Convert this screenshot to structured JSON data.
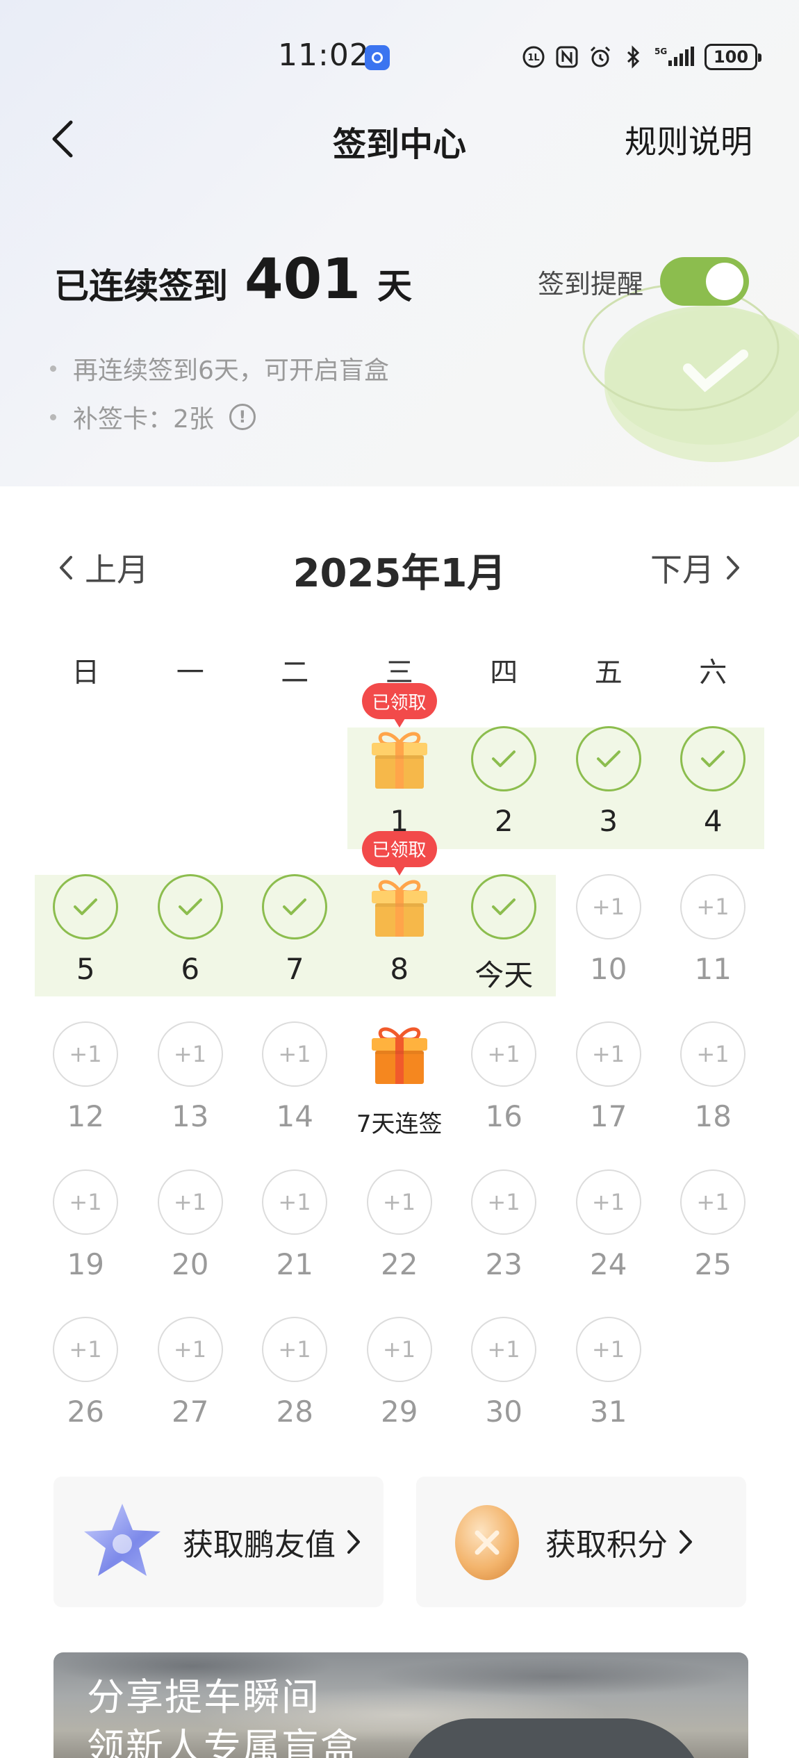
{
  "status_bar": {
    "time": "11:02",
    "battery": "100"
  },
  "nav": {
    "title": "签到中心",
    "rules_label": "规则说明"
  },
  "streak": {
    "prefix": "已连续签到",
    "days": "401",
    "suffix": "天"
  },
  "reminder": {
    "label": "签到提醒",
    "enabled": true
  },
  "tips": [
    "再连续签到6天，可开启盲盒",
    "补签卡：2张"
  ],
  "calendar": {
    "prev_label": "上月",
    "next_label": "下月",
    "month_title": "2025年1月",
    "weekdays": [
      "日",
      "一",
      "二",
      "三",
      "四",
      "五",
      "六"
    ],
    "claimed_badge": "已领取",
    "future_mark": "+1",
    "weeks": [
      [
        {
          "label": ""
        },
        {
          "label": ""
        },
        {
          "label": ""
        },
        {
          "label": "1",
          "state": "gift-claimed"
        },
        {
          "label": "2",
          "state": "checked"
        },
        {
          "label": "3",
          "state": "checked"
        },
        {
          "label": "4",
          "state": "checked"
        }
      ],
      [
        {
          "label": "5",
          "state": "checked"
        },
        {
          "label": "6",
          "state": "checked"
        },
        {
          "label": "7",
          "state": "checked"
        },
        {
          "label": "8",
          "state": "gift-claimed"
        },
        {
          "label": "今天",
          "state": "checked"
        },
        {
          "label": "10",
          "state": "future"
        },
        {
          "label": "11",
          "state": "future"
        }
      ],
      [
        {
          "label": "12",
          "state": "future"
        },
        {
          "label": "13",
          "state": "future"
        },
        {
          "label": "14",
          "state": "future"
        },
        {
          "label": "7天连签",
          "state": "gift"
        },
        {
          "label": "16",
          "state": "future"
        },
        {
          "label": "17",
          "state": "future"
        },
        {
          "label": "18",
          "state": "future"
        }
      ],
      [
        {
          "label": "19",
          "state": "future"
        },
        {
          "label": "20",
          "state": "future"
        },
        {
          "label": "21",
          "state": "future"
        },
        {
          "label": "22",
          "state": "future"
        },
        {
          "label": "23",
          "state": "future"
        },
        {
          "label": "24",
          "state": "future"
        },
        {
          "label": "25",
          "state": "future"
        }
      ],
      [
        {
          "label": "26",
          "state": "future"
        },
        {
          "label": "27",
          "state": "future"
        },
        {
          "label": "28",
          "state": "future"
        },
        {
          "label": "29",
          "state": "future"
        },
        {
          "label": "30",
          "state": "future"
        },
        {
          "label": "31",
          "state": "future"
        },
        {
          "label": ""
        }
      ]
    ]
  },
  "cards": [
    {
      "label": "获取鹏友值",
      "icon": "star-icon"
    },
    {
      "label": "获取积分",
      "icon": "coin-icon"
    }
  ],
  "banner": {
    "line1": "分享提车瞬间",
    "line2": "领新人专属盲盒"
  },
  "colors": {
    "accent_green": "#8cbd4e",
    "band_green": "#f1f7e6",
    "badge_red": "#f24a4a"
  }
}
